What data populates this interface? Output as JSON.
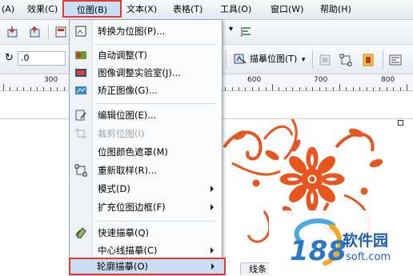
{
  "menubar": {
    "items": [
      {
        "label": "(A)"
      },
      {
        "label": "效果(C)"
      },
      {
        "label": "位图(B)"
      },
      {
        "label": "文本(X)"
      },
      {
        "label": "表格(T)"
      },
      {
        "label": "工具(O)"
      },
      {
        "label": "窗口(W)"
      },
      {
        "label": "帮助(H)"
      }
    ]
  },
  "toolbar": {
    "rotate_value": ".0",
    "trace_label": "描摹位图(T)"
  },
  "ruler": {
    "labels": [
      "300",
      "600",
      "700",
      "800"
    ]
  },
  "dropdown": {
    "items": [
      {
        "label": "转换为位图(P)...",
        "icon": "convert-bitmap-icon"
      },
      {
        "label": "自动调整(T)",
        "icon": "auto-adjust-icon"
      },
      {
        "label": "图像调整实验室(J)...",
        "icon": "image-lab-icon"
      },
      {
        "label": "矫正图像(G)...",
        "icon": "straighten-icon"
      },
      {
        "label": "编辑位图(E)...",
        "icon": "edit-bitmap-icon"
      },
      {
        "label": "裁剪位图(I)",
        "icon": "crop-bitmap-icon",
        "disabled": true
      },
      {
        "label": "位图颜色遮罩(M)"
      },
      {
        "label": "重新取样(R)...",
        "icon": "resample-icon"
      },
      {
        "label": "模式(D)",
        "submenu": true
      },
      {
        "label": "扩充位图边框(F)",
        "submenu": true
      },
      {
        "label": "快速描摹(Q)",
        "icon": "quick-trace-icon"
      },
      {
        "label": "中心线描摹(C)",
        "submenu": true
      },
      {
        "label": "轮廓描摹(O)",
        "submenu": true
      }
    ]
  },
  "tabs": {
    "line_tab": "线条"
  },
  "watermark": {
    "number": "188",
    "brand": "软件园",
    "domain": "soft.com"
  },
  "colors": {
    "highlight_border": "#e23a2e",
    "highlight_fill": "#c9def5",
    "art_orange": "#e8551f"
  }
}
